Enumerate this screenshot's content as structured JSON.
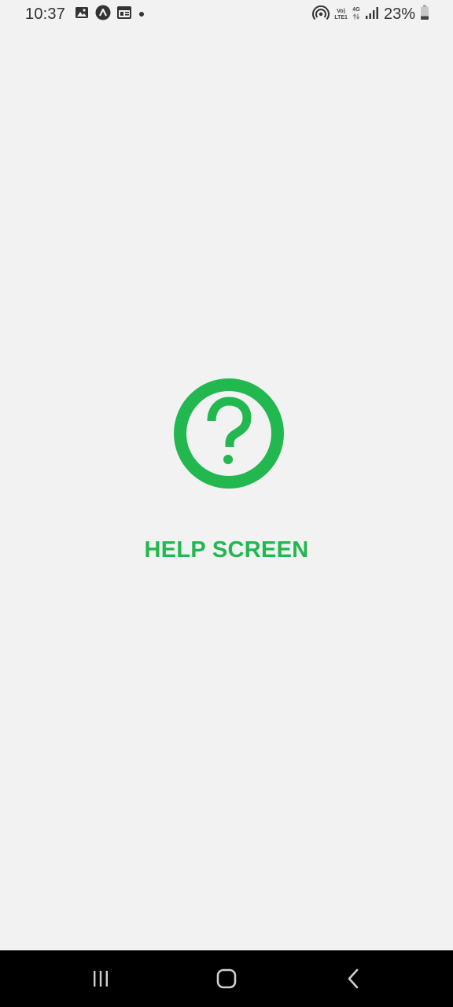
{
  "status_bar": {
    "time": "10:37",
    "volte_top": "Vo)",
    "volte_bottom": "LTE1",
    "network_type": "4G",
    "battery_percent": "23%"
  },
  "main": {
    "title": "HELP SCREEN",
    "icon": "help-circle-icon",
    "accent_color": "#22b84f"
  },
  "nav_bar": {
    "buttons": [
      "recent-apps",
      "home",
      "back"
    ]
  }
}
